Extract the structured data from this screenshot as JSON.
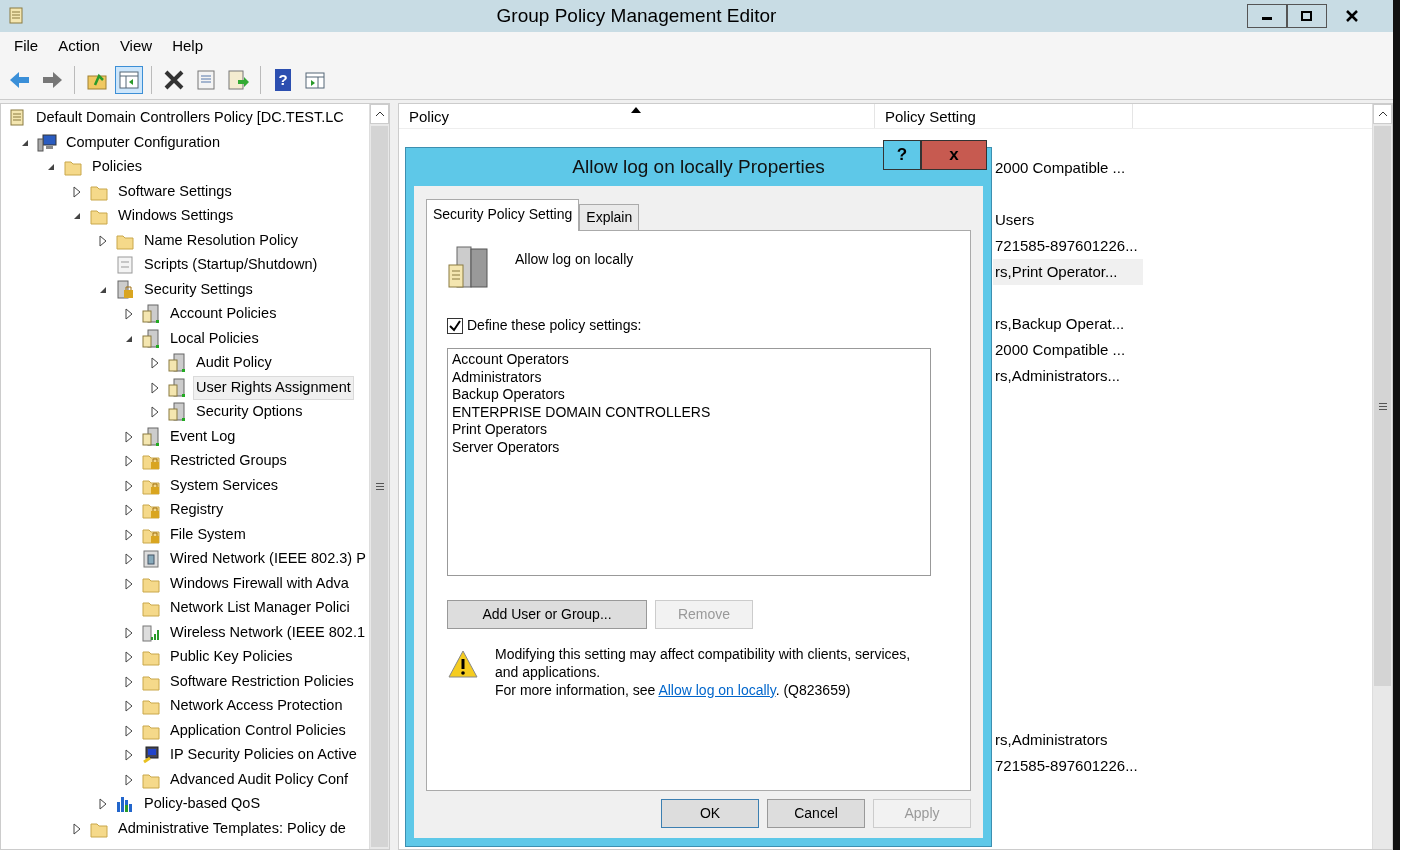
{
  "window": {
    "title": "Group Policy Management Editor"
  },
  "menu": [
    "File",
    "Action",
    "View",
    "Help"
  ],
  "toolbar": [
    {
      "kind": "back",
      "selected": false
    },
    {
      "kind": "forward",
      "selected": false
    },
    {
      "kind": "sep"
    },
    {
      "kind": "up",
      "selected": false
    },
    {
      "kind": "tree",
      "selected": true
    },
    {
      "kind": "sep"
    },
    {
      "kind": "delete",
      "selected": false
    },
    {
      "kind": "properties",
      "selected": false
    },
    {
      "kind": "export",
      "selected": false
    },
    {
      "kind": "sep"
    },
    {
      "kind": "help",
      "glyph": "?",
      "selected": false
    },
    {
      "kind": "action",
      "selected": false
    }
  ],
  "tree": [
    {
      "label": "Default Domain Controllers Policy [DC.TEST.LC",
      "kind": "scroll",
      "selected": false,
      "children": [
        {
          "label": "Computer Configuration",
          "kind": "computer",
          "expanded": true,
          "selected": false,
          "children": [
            {
              "label": "Policies",
              "kind": "folder",
              "expanded": true,
              "selected": false,
              "children": [
                {
                  "label": "Software Settings",
                  "kind": "folder",
                  "expanded": false,
                  "selected": false
                },
                {
                  "label": "Windows Settings",
                  "kind": "folder",
                  "expanded": true,
                  "selected": false,
                  "children": [
                    {
                      "label": "Name Resolution Policy",
                      "kind": "folder",
                      "expanded": false,
                      "selected": false
                    },
                    {
                      "label": "Scripts (Startup/Shutdown)",
                      "kind": "script",
                      "selected": false
                    },
                    {
                      "label": "Security Settings",
                      "kind": "lockserver",
                      "expanded": true,
                      "selected": false,
                      "children": [
                        {
                          "label": "Account Policies",
                          "kind": "server",
                          "expanded": false,
                          "selected": false
                        },
                        {
                          "label": "Local Policies",
                          "kind": "server",
                          "expanded": true,
                          "selected": false,
                          "children": [
                            {
                              "label": "Audit Policy",
                              "kind": "server",
                              "expanded": false,
                              "selected": false
                            },
                            {
                              "label": "User Rights Assignment",
                              "kind": "server",
                              "expanded": false,
                              "selected": true
                            },
                            {
                              "label": "Security Options",
                              "kind": "server",
                              "expanded": false,
                              "selected": false
                            }
                          ]
                        },
                        {
                          "label": "Event Log",
                          "kind": "server",
                          "expanded": false,
                          "selected": false
                        },
                        {
                          "label": "Restricted Groups",
                          "kind": "lockfolder",
                          "expanded": false,
                          "selected": false
                        },
                        {
                          "label": "System Services",
                          "kind": "lockfolder",
                          "expanded": false,
                          "selected": false
                        },
                        {
                          "label": "Registry",
                          "kind": "lockfolder",
                          "expanded": false,
                          "selected": false
                        },
                        {
                          "label": "File System",
                          "kind": "lockfolder",
                          "expanded": false,
                          "selected": false
                        },
                        {
                          "label": "Wired Network (IEEE 802.3) P",
                          "kind": "wired",
                          "expanded": false,
                          "selected": false
                        },
                        {
                          "label": "Windows Firewall with Adva",
                          "kind": "folder",
                          "expanded": false,
                          "selected": false
                        },
                        {
                          "label": "Network List Manager Polici",
                          "kind": "folder",
                          "selected": false
                        },
                        {
                          "label": "Wireless Network (IEEE 802.1",
                          "kind": "wireless",
                          "expanded": false,
                          "selected": false
                        },
                        {
                          "label": "Public Key Policies",
                          "kind": "folder",
                          "expanded": false,
                          "selected": false
                        },
                        {
                          "label": "Software Restriction Policies",
                          "kind": "folder",
                          "expanded": false,
                          "selected": false
                        },
                        {
                          "label": "Network Access Protection",
                          "kind": "folder",
                          "expanded": false,
                          "selected": false
                        },
                        {
                          "label": "Application Control Policies",
                          "kind": "folder",
                          "expanded": false,
                          "selected": false
                        },
                        {
                          "label": "IP Security Policies on Active",
                          "kind": "ipsec",
                          "expanded": false,
                          "selected": false
                        },
                        {
                          "label": "Advanced Audit Policy Conf",
                          "kind": "folder",
                          "expanded": false,
                          "selected": false
                        }
                      ]
                    },
                    {
                      "label": "Policy-based QoS",
                      "kind": "chart",
                      "expanded": false,
                      "selected": false
                    }
                  ]
                },
                {
                  "label": "Administrative Templates: Policy de",
                  "kind": "folder",
                  "expanded": false,
                  "selected": false
                }
              ]
            }
          ]
        }
      ]
    }
  ],
  "list": {
    "columns": [
      "Policy",
      "Policy Setting"
    ],
    "rows": [
      {
        "selected": false
      },
      {
        "setting": "2000 Compatible ...",
        "selected": false
      },
      {
        "selected": false
      },
      {
        "setting": "Users",
        "selected": false
      },
      {
        "setting": "721585-897601226...",
        "selected": false
      },
      {
        "setting": "rs,Print Operator...",
        "selected": true
      },
      {
        "selected": false
      },
      {
        "setting": "rs,Backup Operat...",
        "selected": false
      },
      {
        "setting": "2000 Compatible ...",
        "selected": false
      },
      {
        "setting": "rs,Administrators...",
        "selected": false
      },
      {
        "selected": false
      },
      {
        "selected": false
      },
      {
        "selected": false
      },
      {
        "selected": false
      },
      {
        "selected": false
      },
      {
        "selected": false
      },
      {
        "selected": false
      },
      {
        "selected": false
      },
      {
        "selected": false
      },
      {
        "selected": false
      },
      {
        "selected": false
      },
      {
        "selected": false
      },
      {
        "selected": false
      },
      {
        "setting": "rs,Administrators",
        "selected": false
      },
      {
        "setting": "721585-897601226...",
        "selected": false
      }
    ]
  },
  "dialog": {
    "title": "Allow log on locally Properties",
    "help": "?",
    "close": "x",
    "tabs": [
      {
        "label": "Security Policy Setting",
        "selected": true
      },
      {
        "label": "Explain",
        "selected": false
      }
    ],
    "policy_name": "Allow log on locally",
    "define": {
      "label": "Define these policy settings:",
      "checked": true
    },
    "members": [
      "Account Operators",
      "Administrators",
      "Backup Operators",
      "ENTERPRISE DOMAIN CONTROLLERS",
      "Print Operators",
      "Server Operators"
    ],
    "member_buttons": [
      {
        "label": "Add User or Group...",
        "disabled": false
      },
      {
        "label": "Remove",
        "disabled": true
      }
    ],
    "warning": "Modifying this setting may affect compatibility with clients, services, and applications.",
    "info": {
      "before": "For more information, see ",
      "link": "Allow log on locally",
      "after": ". (Q823659)"
    },
    "buttons": [
      {
        "label": "OK",
        "disabled": false,
        "default": true
      },
      {
        "label": "Cancel",
        "disabled": false,
        "default": false
      },
      {
        "label": "Apply",
        "disabled": true,
        "default": false
      }
    ]
  }
}
